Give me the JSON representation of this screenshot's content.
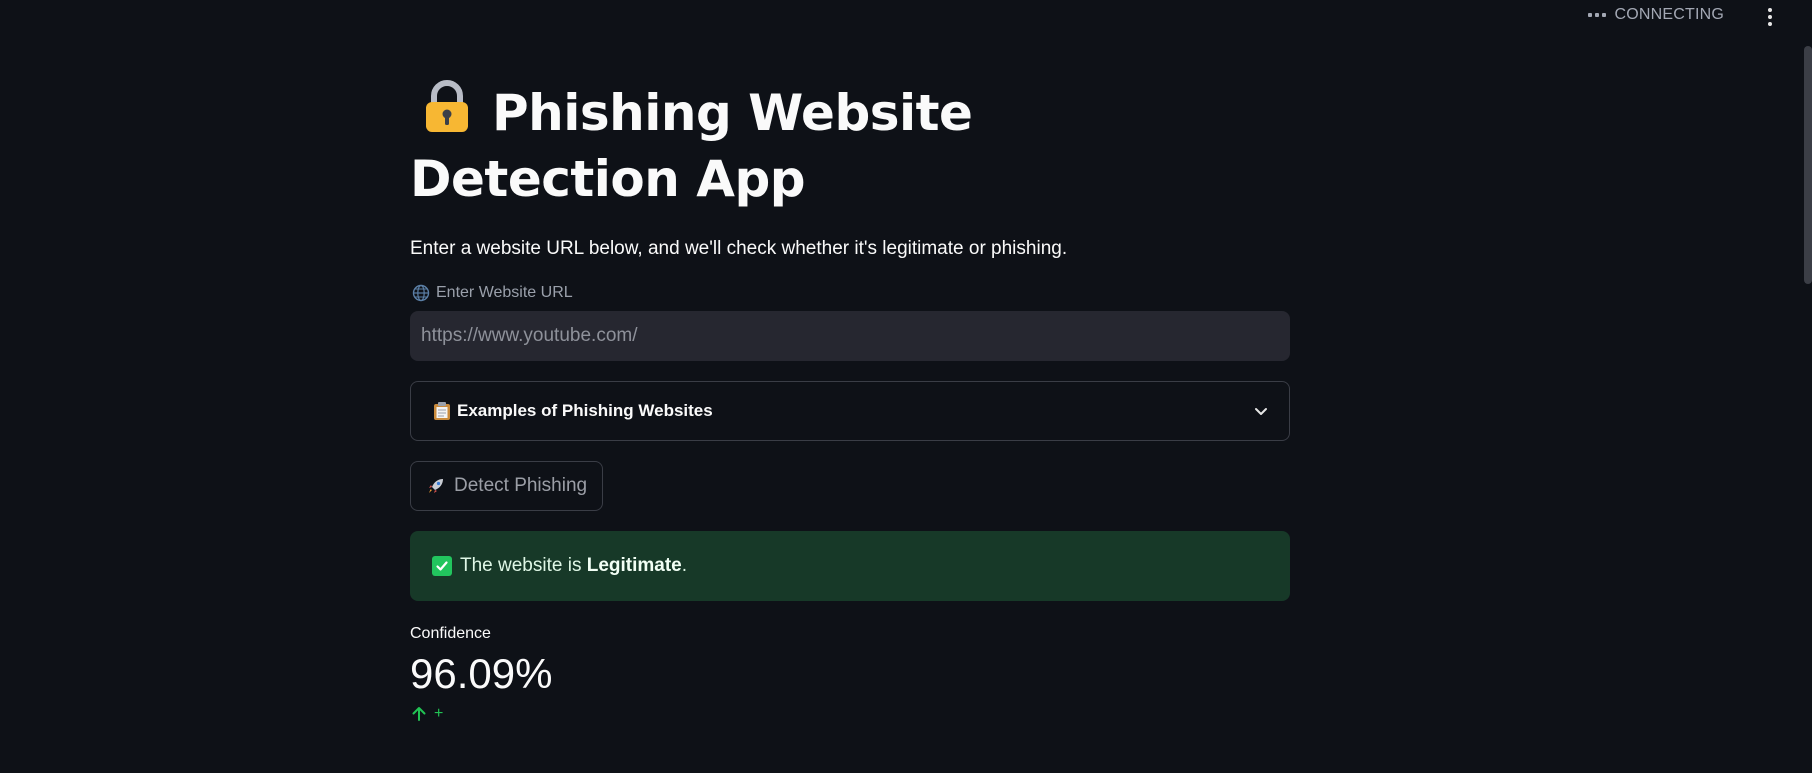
{
  "topbar": {
    "status_text": "CONNECTING"
  },
  "app": {
    "title": "Phishing Website Detection App",
    "title_icon": "lock-icon",
    "subtitle": "Enter a website URL below, and we'll check whether it's legitimate or phishing."
  },
  "url_input": {
    "label": "Enter Website URL",
    "label_icon": "globe-icon",
    "placeholder": "https://www.youtube.com/"
  },
  "examples_expander": {
    "label": "Examples of Phishing Websites",
    "icon": "clipboard-icon",
    "expanded": false
  },
  "detect_button": {
    "label": "Detect Phishing",
    "icon": "rocket-icon"
  },
  "result_alert": {
    "prefix": "The website is ",
    "verdict": "Legitimate",
    "suffix": ".",
    "icon": "check-box-icon",
    "background_color": "#173928"
  },
  "confidence_metric": {
    "label": "Confidence",
    "value": "96.09%",
    "delta": "+",
    "delta_color": "#21c354"
  }
}
